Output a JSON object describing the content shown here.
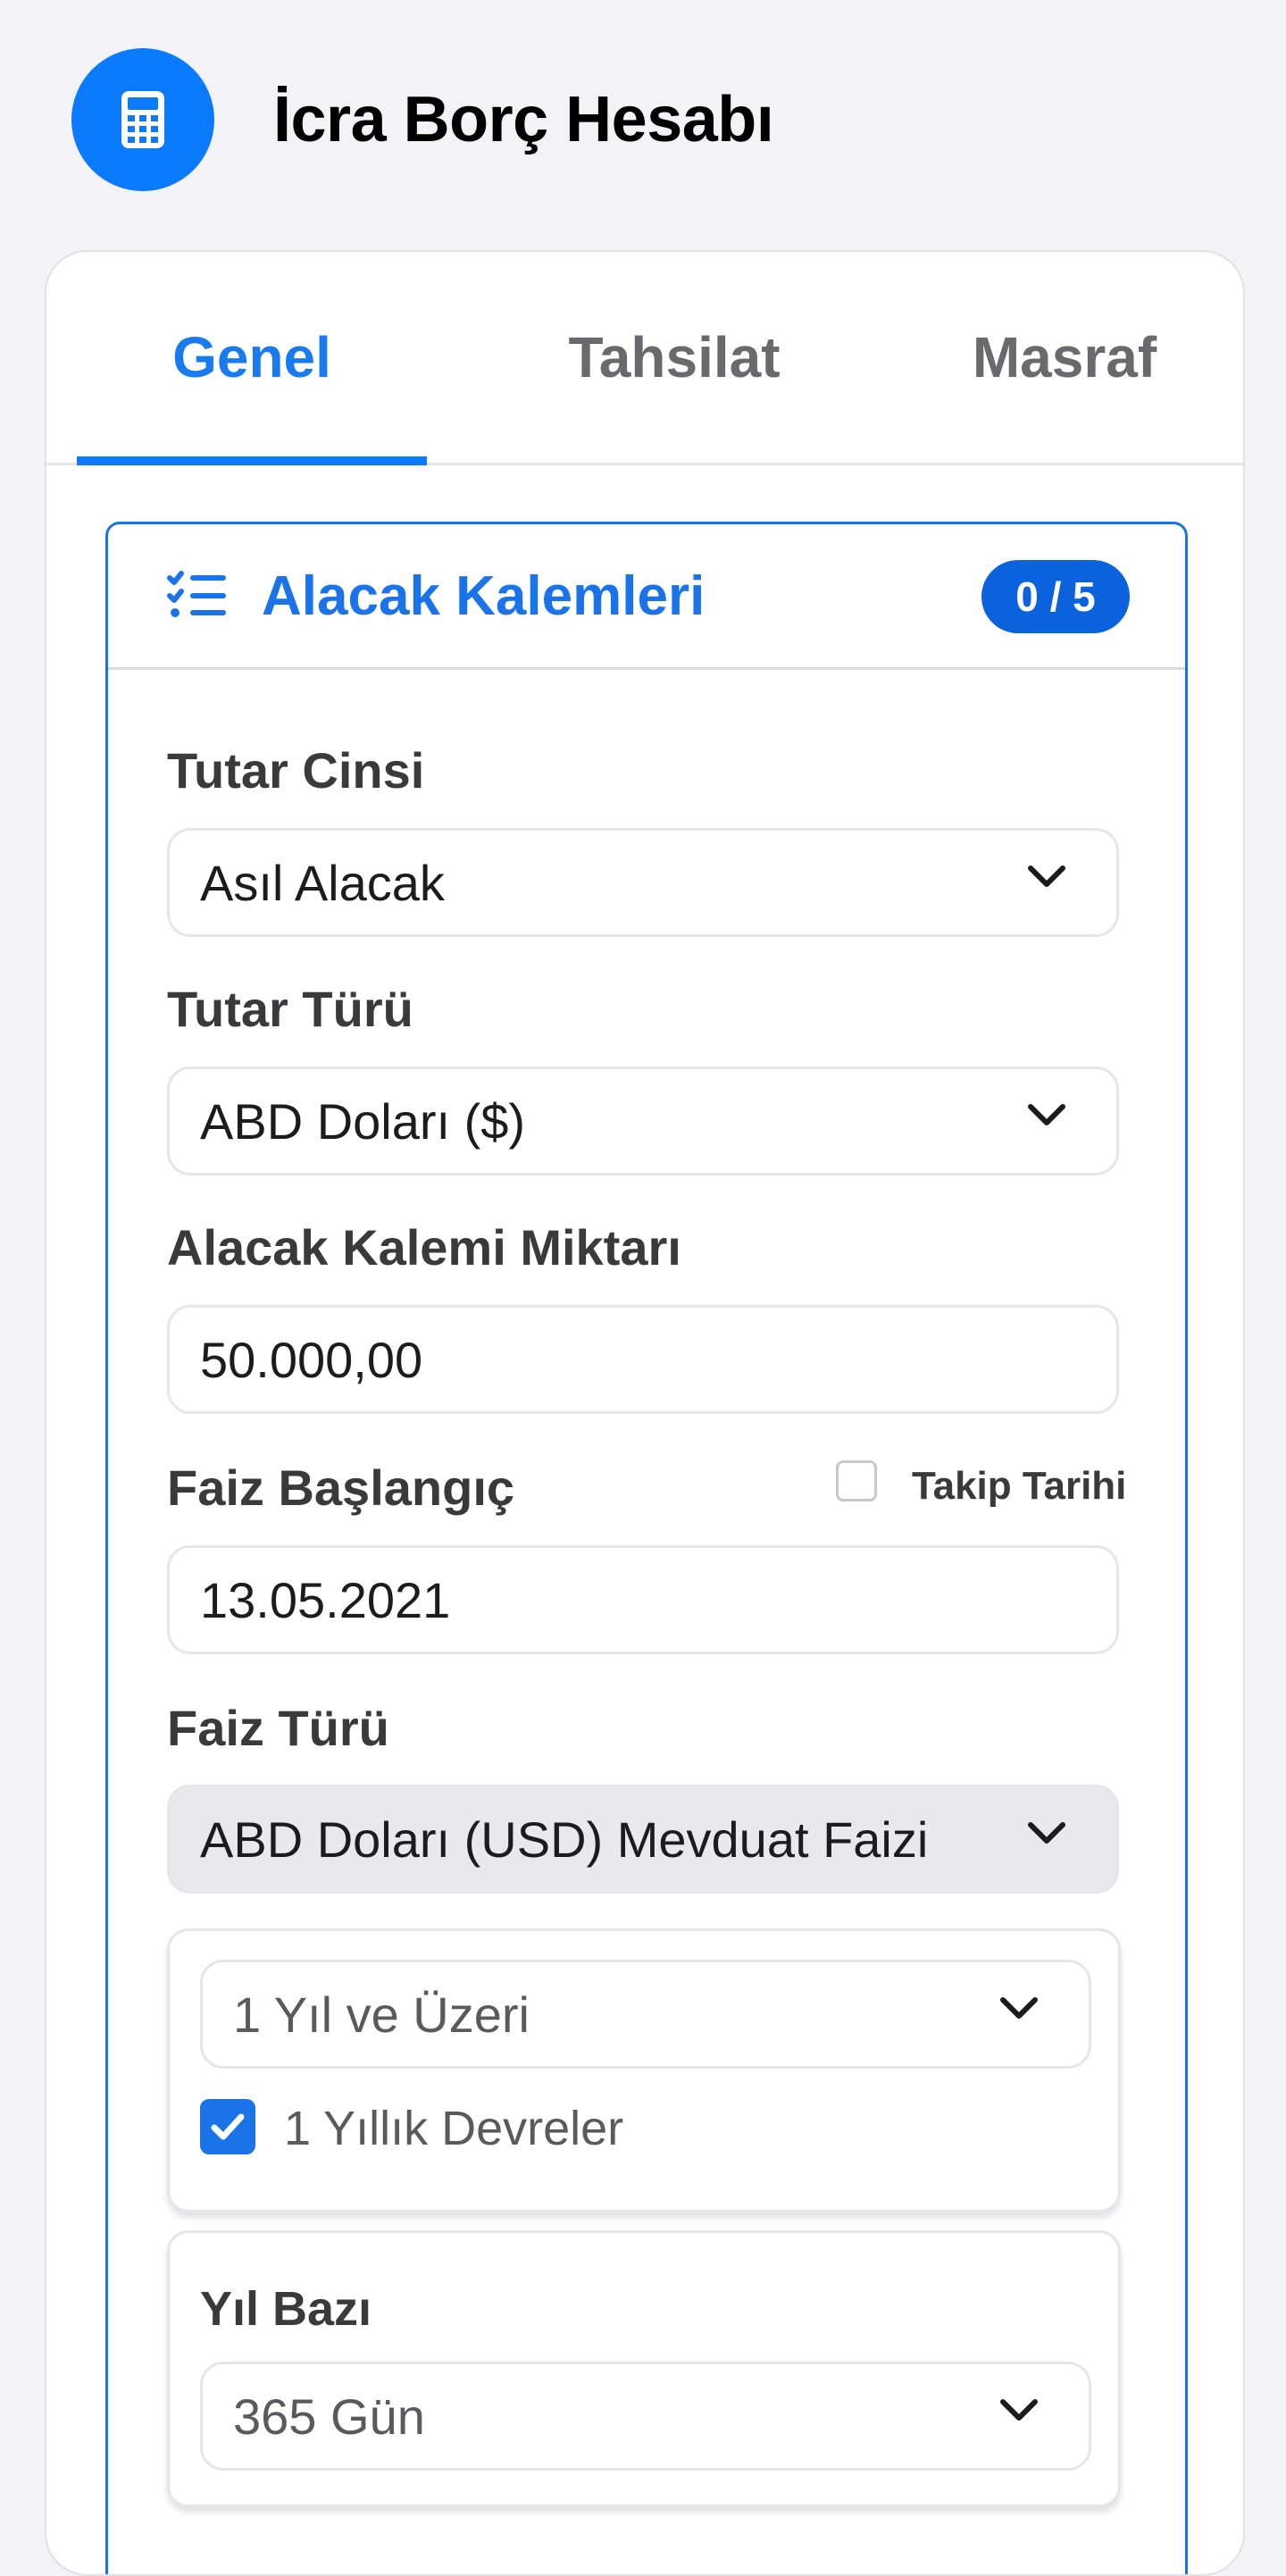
{
  "app": {
    "title": "İcra Borç Hesabı",
    "icon": "calculator-icon",
    "accent": "#0a7aff"
  },
  "tabs": [
    {
      "label": "Genel",
      "active": true
    },
    {
      "label": "Tahsilat",
      "active": false
    },
    {
      "label": "Masraf",
      "active": false
    }
  ],
  "section": {
    "title": "Alacak Kalemleri",
    "icon": "checklist-icon",
    "badge": "0 / 5"
  },
  "form": {
    "tutar_cinsi": {
      "label": "Tutar Cinsi",
      "value": "Asıl Alacak"
    },
    "tutar_turu": {
      "label": "Tutar Türü",
      "value": "ABD Doları ($)"
    },
    "miktar": {
      "label": "Alacak Kalemi Miktarı",
      "value": "50.000,00"
    },
    "faiz_baslangic": {
      "label": "Faiz Başlangıç",
      "value": "13.05.2021",
      "checkbox_label": "Takip Tarihi",
      "checked": false
    },
    "faiz_turu": {
      "label": "Faiz Türü",
      "value": "ABD Doları (USD) Mevduat Faizi"
    },
    "vade": {
      "value": "1 Yıl ve Üzeri",
      "checkbox_label": "1 Yıllık Devreler",
      "checked": true
    },
    "yil_bazi": {
      "label": "Yıl Bazı",
      "value": "365 Gün"
    }
  }
}
